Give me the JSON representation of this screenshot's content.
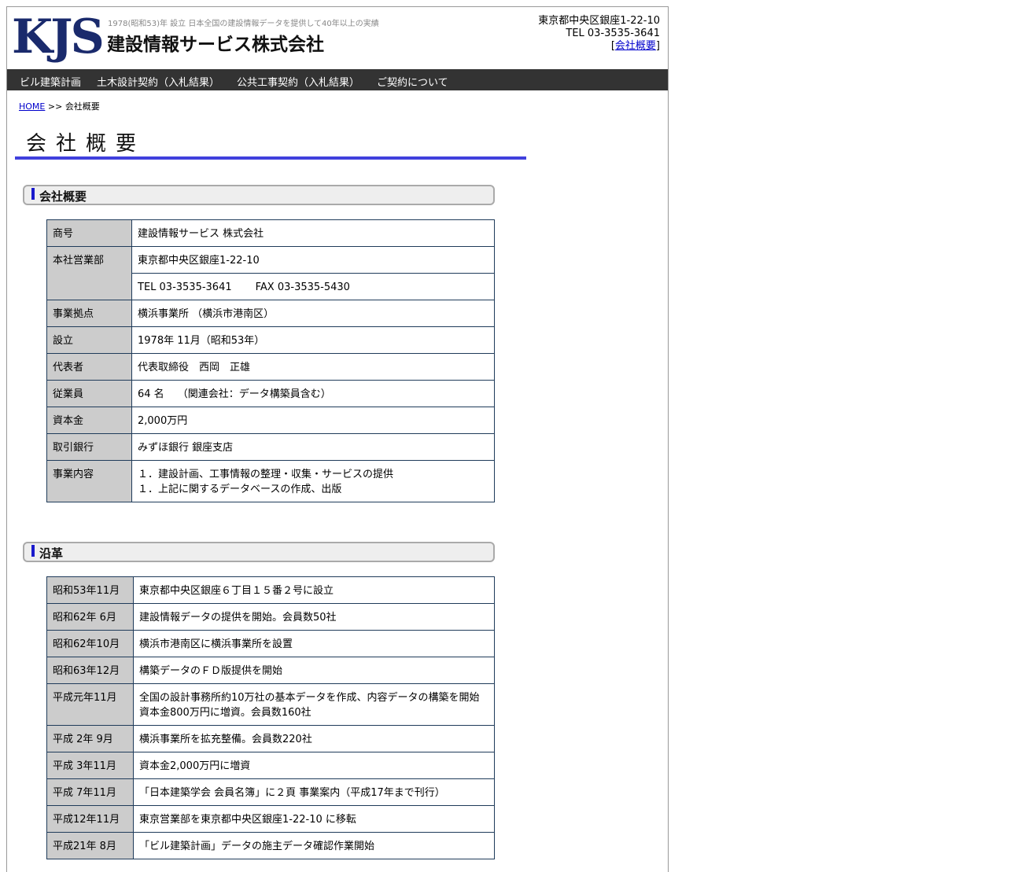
{
  "header": {
    "logo": "KJS",
    "tagline": "1978(昭和53)年 設立 日本全国の建設情報データを提供して40年以上の実績",
    "company": "建設情報サービス株式会社",
    "address": "東京都中央区銀座1-22-10",
    "tel": "TEL 03-3535-3641",
    "about_link": "会社概要"
  },
  "nav": [
    "ビル建築計画",
    "土木設計契約（入札結果）",
    "公共工事契約（入札結果）",
    "ご契約について"
  ],
  "breadcrumb": {
    "home": "HOME",
    "sep": " >> ",
    "current": "会社概要"
  },
  "page_title": "会社概要",
  "sections": {
    "overview": "会社概要",
    "history": "沿革"
  },
  "overview": {
    "trade_name_label": "商号",
    "trade_name": "建設情報サービス 株式会社",
    "hq_label": "本社営業部",
    "hq_address": "東京都中央区銀座1-22-10",
    "hq_tel": "TEL 03-3535-3641",
    "hq_fax": "FAX 03-3535-5430",
    "branch_label": "事業拠点",
    "branch": "横浜事業所 （横浜市港南区）",
    "founded_label": "設立",
    "founded": "1978年 11月（昭和53年）",
    "rep_label": "代表者",
    "rep": "代表取締役　西岡　正雄",
    "staff_label": "従業員",
    "staff": "64 名　 （関連会社：データ構築員含む）",
    "capital_label": "資本金",
    "capital": "2,000万円",
    "bank_label": "取引銀行",
    "bank": "みずほ銀行 銀座支店",
    "biz_label": "事業内容",
    "biz_1": "１．建設計画、工事情報の整理・収集・サービスの提供",
    "biz_2": "１．上記に関するデータベースの作成、出版"
  },
  "history": [
    {
      "date": "昭和53年11月",
      "lines": [
        "東京都中央区銀座６丁目１５番２号に設立"
      ]
    },
    {
      "date": "昭和62年 6月",
      "lines": [
        "建設情報データの提供を開始。会員数50社"
      ]
    },
    {
      "date": "昭和62年10月",
      "lines": [
        "横浜市港南区に横浜事業所を設置"
      ]
    },
    {
      "date": "昭和63年12月",
      "lines": [
        "構築データのＦＤ版提供を開始"
      ]
    },
    {
      "date": "平成元年11月",
      "lines": [
        "全国の設計事務所約10万社の基本データを作成、内容データの構築を開始",
        "資本金800万円に増資。会員数160社"
      ]
    },
    {
      "date": "平成 2年 9月",
      "lines": [
        "横浜事業所を拡充整備。会員数220社"
      ]
    },
    {
      "date": "平成 3年11月",
      "lines": [
        "資本金2,000万円に増資"
      ]
    },
    {
      "date": "平成 7年11月",
      "lines": [
        "「日本建築学会 会員名簿」に２頁 事業案内（平成17年まで刊行）"
      ]
    },
    {
      "date": "平成12年11月",
      "lines": [
        "東京営業部を東京都中央区銀座1-22-10 に移転"
      ]
    },
    {
      "date": "平成21年 8月",
      "lines": [
        "「ビル建築計画」データの施主データ確認作業開始"
      ]
    }
  ]
}
